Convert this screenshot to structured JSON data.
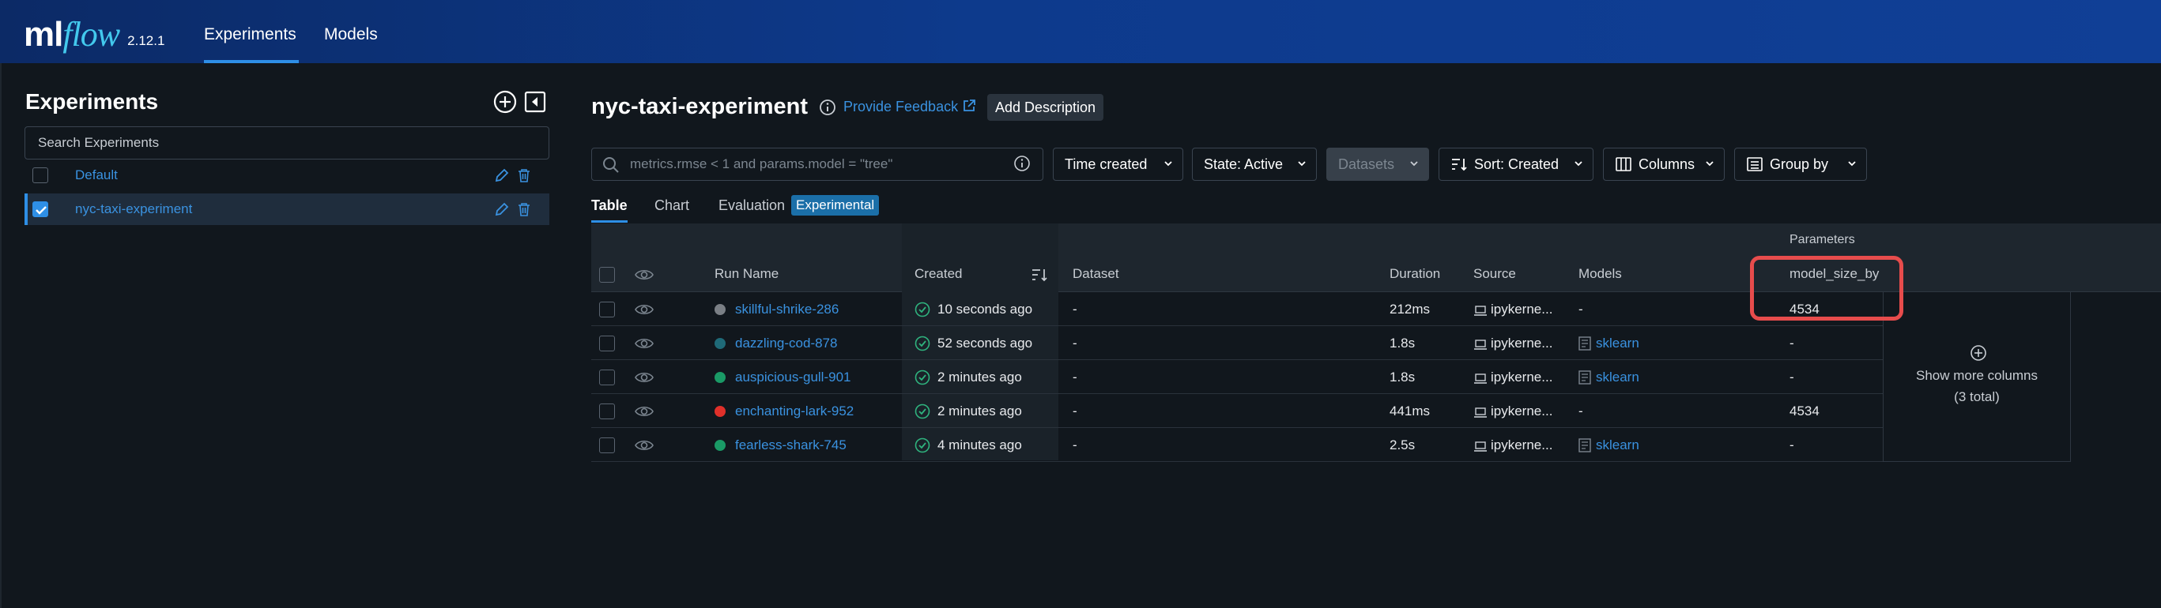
{
  "app": {
    "logo_ml": "ml",
    "logo_flow": "flow",
    "version": "2.12.1",
    "nav": [
      "Experiments",
      "Models"
    ]
  },
  "sidebar": {
    "title": "Experiments",
    "search_placeholder": "Search Experiments",
    "experiments": [
      {
        "name": "Default",
        "checked": false
      },
      {
        "name": "nyc-taxi-experiment",
        "checked": true
      }
    ]
  },
  "main": {
    "title": "nyc-taxi-experiment",
    "feedback_link": "Provide Feedback",
    "add_description": "Add Description",
    "query_placeholder": "metrics.rmse < 1 and params.model = \"tree\"",
    "toolbar": {
      "time_created": "Time created",
      "state": "State: Active",
      "datasets": "Datasets",
      "sort": "Sort: Created",
      "columns": "Columns",
      "group_by": "Group by"
    },
    "view_tabs": [
      "Table",
      "Chart",
      "Evaluation"
    ],
    "experimental_badge": "Experimental"
  },
  "table": {
    "group_header": "Parameters",
    "columns": [
      "Run Name",
      "Created",
      "Dataset",
      "Duration",
      "Source",
      "Models",
      "model_size_by"
    ],
    "rows": [
      {
        "run_name": "skillful-shrike-286",
        "color": "#7a7f85",
        "created": "10 seconds ago",
        "dataset": "-",
        "duration": "212ms",
        "source": "ipykerne...",
        "models": "-",
        "model_size": "4534"
      },
      {
        "run_name": "dazzling-cod-878",
        "color": "#1f6a78",
        "created": "52 seconds ago",
        "dataset": "-",
        "duration": "1.8s",
        "source": "ipykerne...",
        "models": "sklearn",
        "model_size": "-"
      },
      {
        "run_name": "auspicious-gull-901",
        "color": "#1a9a66",
        "created": "2 minutes ago",
        "dataset": "-",
        "duration": "1.8s",
        "source": "ipykerne...",
        "models": "sklearn",
        "model_size": "-"
      },
      {
        "run_name": "enchanting-lark-952",
        "color": "#e0302a",
        "created": "2 minutes ago",
        "dataset": "-",
        "duration": "441ms",
        "source": "ipykerne...",
        "models": "-",
        "model_size": "4534"
      },
      {
        "run_name": "fearless-shark-745",
        "color": "#1a9a66",
        "created": "4 minutes ago",
        "dataset": "-",
        "duration": "2.5s",
        "source": "ipykerne...",
        "models": "sklearn",
        "model_size": "-"
      }
    ],
    "show_more_line1": "Show more columns",
    "show_more_line2": "(3 total)"
  }
}
